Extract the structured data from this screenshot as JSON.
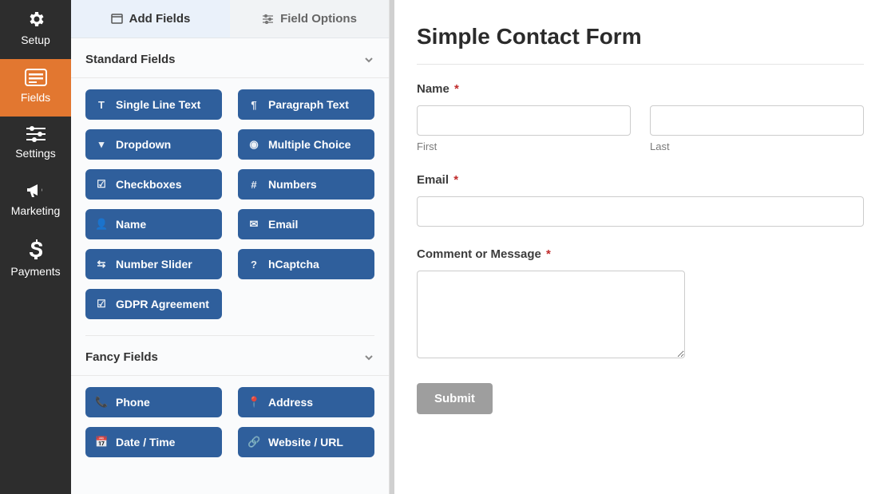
{
  "nav": {
    "items": [
      {
        "label": "Setup",
        "icon": "gear"
      },
      {
        "label": "Fields",
        "icon": "form"
      },
      {
        "label": "Settings",
        "icon": "sliders"
      },
      {
        "label": "Marketing",
        "icon": "bullhorn"
      },
      {
        "label": "Payments",
        "icon": "dollar"
      }
    ],
    "active_index": 1
  },
  "tabs": {
    "add_fields": "Add Fields",
    "field_options": "Field Options",
    "active": "add_fields"
  },
  "sections": {
    "standard": {
      "title": "Standard Fields",
      "fields": [
        {
          "label": "Single Line Text",
          "icon": "T"
        },
        {
          "label": "Paragraph Text",
          "icon": "¶"
        },
        {
          "label": "Dropdown",
          "icon": "▾"
        },
        {
          "label": "Multiple Choice",
          "icon": "◉"
        },
        {
          "label": "Checkboxes",
          "icon": "☑"
        },
        {
          "label": "Numbers",
          "icon": "#"
        },
        {
          "label": "Name",
          "icon": "👤"
        },
        {
          "label": "Email",
          "icon": "✉"
        },
        {
          "label": "Number Slider",
          "icon": "⇆"
        },
        {
          "label": "hCaptcha",
          "icon": "?"
        },
        {
          "label": "GDPR Agreement",
          "icon": "☑"
        }
      ]
    },
    "fancy": {
      "title": "Fancy Fields",
      "fields": [
        {
          "label": "Phone",
          "icon": "📞"
        },
        {
          "label": "Address",
          "icon": "📍"
        },
        {
          "label": "Date / Time",
          "icon": "📅"
        },
        {
          "label": "Website / URL",
          "icon": "🔗"
        }
      ]
    }
  },
  "form": {
    "title": "Simple Contact Form",
    "name_label": "Name",
    "first_label": "First",
    "last_label": "Last",
    "email_label": "Email",
    "message_label": "Comment or Message",
    "submit_label": "Submit",
    "required_marker": "*"
  }
}
